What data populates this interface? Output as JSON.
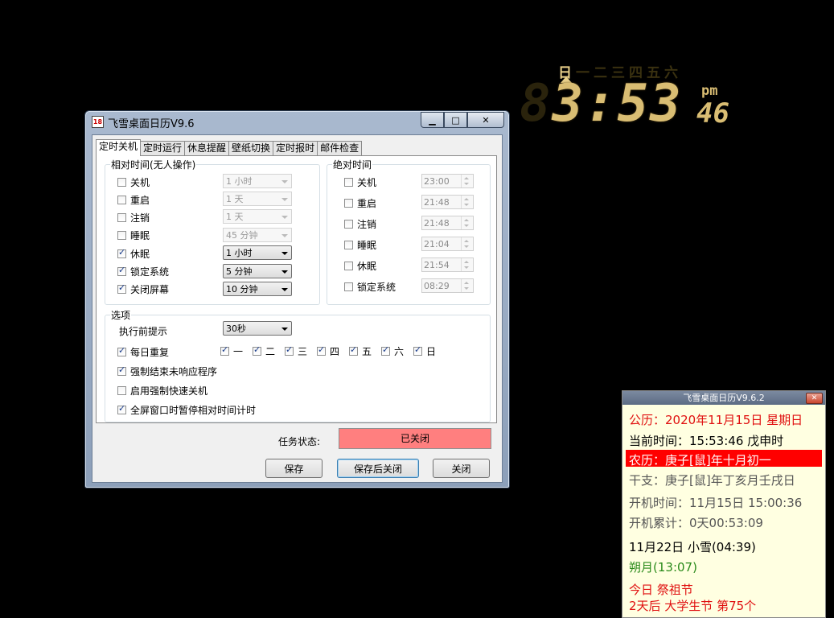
{
  "desktop_clock": {
    "weekdays": [
      "日",
      "一",
      "二",
      "三",
      "四",
      "五",
      "六"
    ],
    "active_weekday": "日",
    "ghost_digit": "8",
    "time": "3:53",
    "ampm": "pm",
    "seconds": "46"
  },
  "window": {
    "title": "飞雪桌面日历V9.6",
    "tabs": [
      "定时关机",
      "定时运行",
      "休息提醒",
      "壁纸切换",
      "定时报时",
      "邮件检查"
    ],
    "relative": {
      "label": "相对时间(无人操作)",
      "items": [
        {
          "label": "关机",
          "checked": false,
          "value": "1 小时",
          "enabled": false
        },
        {
          "label": "重启",
          "checked": false,
          "value": "1 天",
          "enabled": false
        },
        {
          "label": "注销",
          "checked": false,
          "value": "1 天",
          "enabled": false
        },
        {
          "label": "睡眠",
          "checked": false,
          "value": "45 分钟",
          "enabled": false
        },
        {
          "label": "休眠",
          "checked": true,
          "value": "1 小时",
          "enabled": true
        },
        {
          "label": "锁定系统",
          "checked": true,
          "value": "5 分钟",
          "enabled": true
        },
        {
          "label": "关闭屏幕",
          "checked": true,
          "value": "10 分钟",
          "enabled": true
        }
      ]
    },
    "absolute": {
      "label": "绝对时间",
      "items": [
        {
          "label": "关机",
          "checked": false,
          "value": "23:00"
        },
        {
          "label": "重启",
          "checked": false,
          "value": "21:48"
        },
        {
          "label": "注销",
          "checked": false,
          "value": "21:48"
        },
        {
          "label": "睡眠",
          "checked": false,
          "value": "21:04"
        },
        {
          "label": "休眠",
          "checked": false,
          "value": "21:54"
        },
        {
          "label": "锁定系统",
          "checked": false,
          "value": "08:29"
        }
      ]
    },
    "options": {
      "label": "选项",
      "prompt_label": "执行前提示",
      "prompt_value": "30秒",
      "daily_label": "每日重复",
      "days": [
        "一",
        "二",
        "三",
        "四",
        "五",
        "六",
        "日"
      ],
      "force_close_label": "强制结束未响应程序",
      "fast_shutdown_label": "启用强制快速关机",
      "fullscreen_pause_label": "全屏窗口时暂停相对时间计时"
    },
    "status_label": "任务状态:",
    "status_value": "已关闭",
    "buttons": {
      "save": "保存",
      "save_close": "保存后关闭",
      "close": "关闭"
    }
  },
  "calendar": {
    "title": "飞雪桌面日历V9.6.2",
    "lines": {
      "solar": "公历：2020年11月15日 星期日",
      "current_time": "当前时间：15:53:46 戊申时",
      "lunar": "农历：庚子[鼠]年十月初一",
      "ganzhi": "干支：庚子[鼠]年丁亥月壬戌日",
      "boot_time": "开机时间：11月15日 15:00:36",
      "uptime": "开机累计：0天00:53:09",
      "solar_term": "11月22日 小雪(04:39)",
      "moon": "朔月(13:07)",
      "festival_today": "今日 祭祖节",
      "festival_next": "2天后 大学生节 第75个"
    }
  }
}
